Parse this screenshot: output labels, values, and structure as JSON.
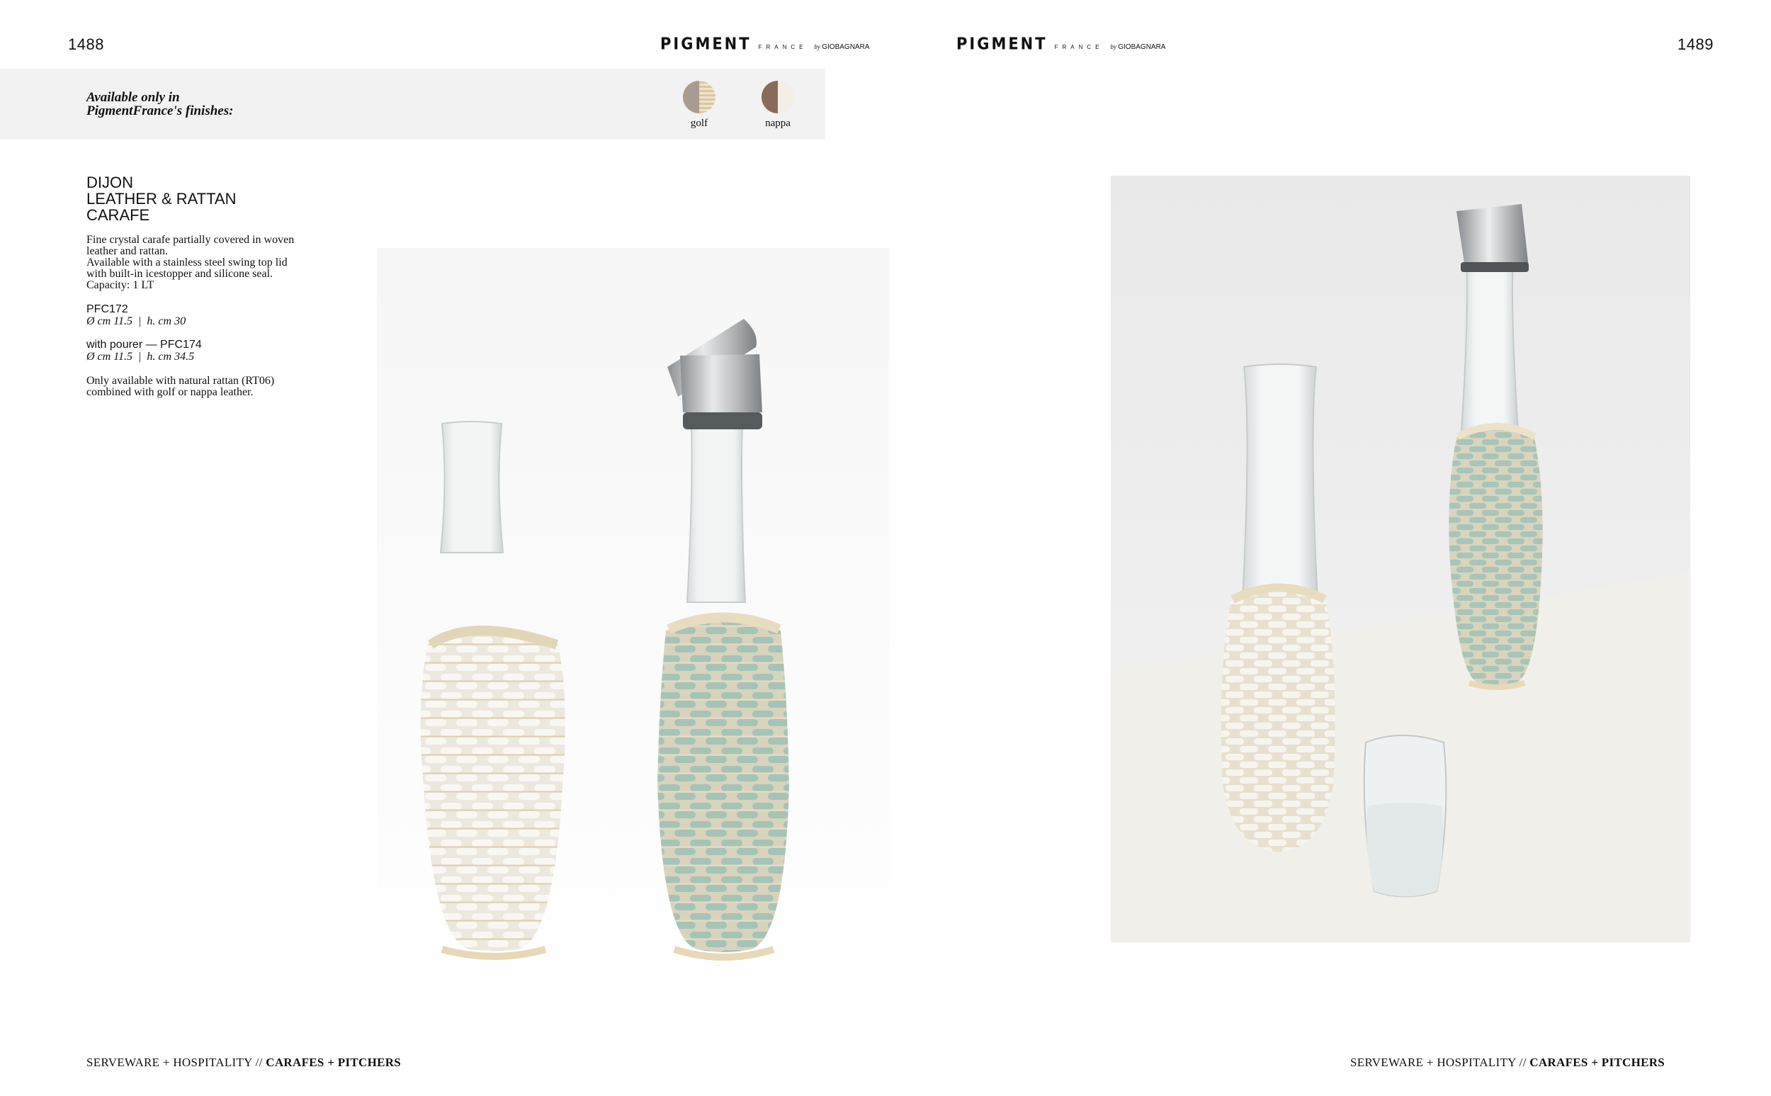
{
  "left_page": {
    "page_number": "1488",
    "brand": {
      "main": "PIGMENT",
      "sub": "FRANCE",
      "by": "by",
      "maker": "GIOBAGNARA"
    },
    "finishes": {
      "title_line1": "Available only in",
      "title_line2": "PigmentFrance's finishes:",
      "items": [
        {
          "label": "golf",
          "color": "#a89c8e"
        },
        {
          "label": "nappa",
          "color": "#8a6a5a"
        }
      ]
    },
    "product": {
      "title_line1": "DIJON",
      "title_line2": "LEATHER & RATTAN",
      "title_line3": "CARAFE",
      "desc_line1": "Fine crystal carafe partially covered in woven",
      "desc_line2": "leather and rattan.",
      "desc_line3": "Available with a stainless steel swing top lid",
      "desc_line4": "with built-in icestopper and silicone seal.",
      "desc_line5": "Capacity: 1 LT",
      "code1": "PFC172",
      "dim1": "Ø cm 11.5  |  h. cm 30",
      "code2": "with pourer — PFC174",
      "dim2": "Ø cm 11.5  |  h. cm 34.5",
      "note_line1": "Only available with natural rattan (RT06)",
      "note_line2": "combined with golf or nappa leather."
    },
    "footer": {
      "section": "SERVEWARE + HOSPITALITY // ",
      "category": "CARAFES + PITCHERS"
    }
  },
  "right_page": {
    "page_number": "1489",
    "brand": {
      "main": "PIGMENT",
      "sub": "FRANCE",
      "by": "by",
      "maker": "GIOBAGNARA"
    },
    "footer": {
      "section": "SERVEWARE + HOSPITALITY // ",
      "category": "CARAFES + PITCHERS"
    }
  },
  "colors": {
    "band": "#f2f2f2",
    "sage": "#a9c4b8",
    "white_leather": "#f1efe9",
    "rattan": "#e6d8b8"
  }
}
